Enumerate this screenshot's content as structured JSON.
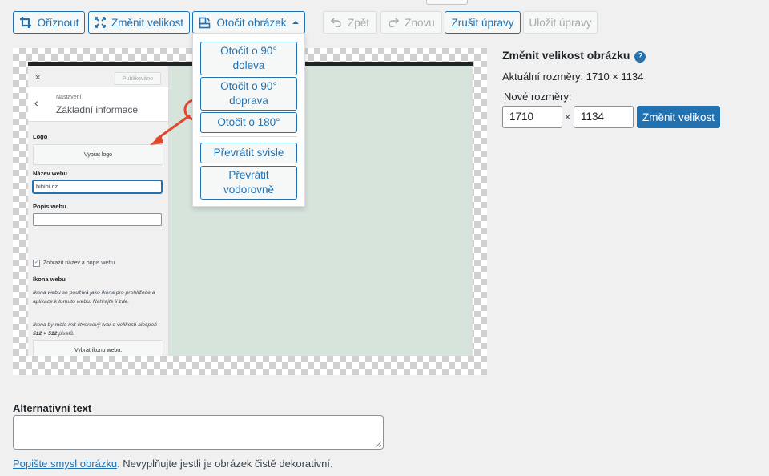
{
  "toolbar": {
    "crop_label": "Oříznout",
    "scale_label": "Změnit velikost",
    "rotate_label": "Otočit obrázek",
    "undo_label": "Zpět",
    "redo_label": "Znovu",
    "cancel_label": "Zrušit úpravy",
    "save_label": "Uložit úpravy"
  },
  "rotate_menu": {
    "items": [
      "Otočit o 90° doleva",
      "Otočit o 90° doprava",
      "Otočit o 180°",
      "Převrátit svisle",
      "Převrátit vodorovně"
    ]
  },
  "preview": {
    "close": "×",
    "published": "Publikováno",
    "back": "‹",
    "settings": "Nastavení",
    "section_title": "Základní informace",
    "logo_label": "Logo",
    "select_logo": "Vybrat logo",
    "site_name_label": "Název webu",
    "site_name_value": "hihihi.cz",
    "tagline_label": "Popis webu",
    "show_title_label": "Zobrazit název a popis webu",
    "site_icon_label": "Ikona webu",
    "site_icon_desc1": "Ikona webu se používá jako ikona pro prohlížeče a aplikace k tomuto webu. Nahrajte ji zde.",
    "site_icon_desc2_a": "Ikona by měla mít čtvercový tvar o velikosti alespoň ",
    "site_icon_desc2_b": "512 × 512",
    "site_icon_desc2_c": " pixelů.",
    "select_icon": "Vybrat ikonu webu."
  },
  "scale": {
    "title": "Změnit velikost obrázku",
    "help": "?",
    "current": "Aktuální rozměry: 1710 × 1134",
    "new_label": "Nové rozměry:",
    "width": "1710",
    "height": "1134",
    "times": "×",
    "button": "Změnit velikost"
  },
  "alt": {
    "label": "Alternativní text",
    "link": "Popište smysl obrázku",
    "note": ". Nevyplňujte jestli je obrázek čistě dekorativní."
  },
  "colors": {
    "accent": "#2271b1",
    "arrow": "#e2462b",
    "preview_bg": "#d6e4dc"
  }
}
